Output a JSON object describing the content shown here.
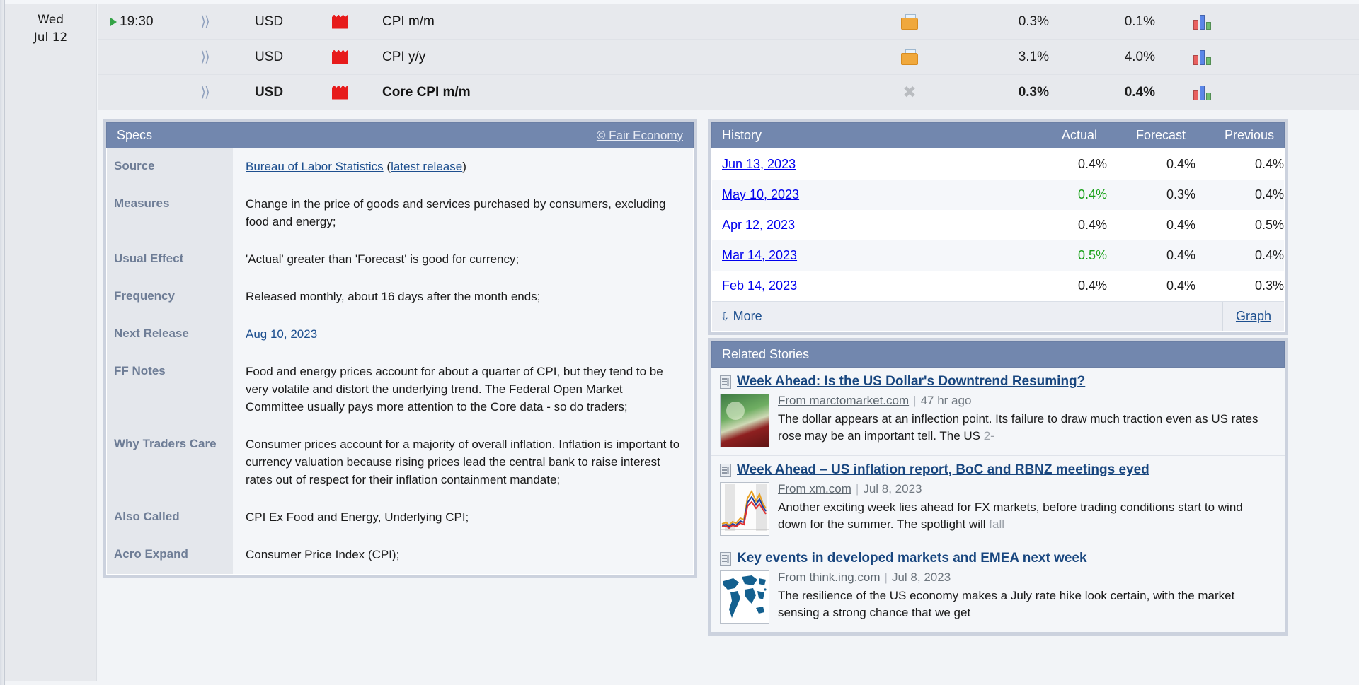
{
  "calendar": {
    "date": {
      "weekday": "Wed",
      "day": "Jul 12"
    },
    "rows": [
      {
        "time": "19:30",
        "has_play": true,
        "sound_icon": "sound-wave-icon",
        "currency": "USD",
        "impact_icon": "red-folder-flag-icon",
        "title": "CPI m/m",
        "detail_icon": "folder-document-icon",
        "actual": "0.3%",
        "forecast": "0.1%",
        "graph_icon": "bar-chart-icon",
        "bold": false
      },
      {
        "time": "",
        "has_play": false,
        "sound_icon": "sound-wave-icon",
        "currency": "USD",
        "impact_icon": "red-folder-flag-icon",
        "title": "CPI y/y",
        "detail_icon": "folder-document-icon",
        "actual": "3.1%",
        "forecast": "4.0%",
        "graph_icon": "bar-chart-icon",
        "bold": false
      },
      {
        "time": "",
        "has_play": false,
        "sound_icon": "sound-wave-icon",
        "currency": "USD",
        "impact_icon": "red-folder-flag-icon",
        "title": "Core CPI m/m",
        "detail_icon": "close-x-icon",
        "actual": "0.3%",
        "forecast": "0.4%",
        "graph_icon": "bar-chart-icon",
        "bold": true
      }
    ]
  },
  "specs": {
    "header_title": "Specs",
    "copyright_link": "© Fair Economy",
    "rows": [
      {
        "label": "Source",
        "value_prefix": "",
        "link1": "Bureau of Labor Statistics",
        "mid": " (",
        "link2": "latest release",
        "suffix": ")"
      },
      {
        "label": "Measures",
        "value": "Change in the price of goods and services purchased by consumers, excluding food and energy;"
      },
      {
        "label": "Usual Effect",
        "value": "'Actual' greater than 'Forecast' is good for currency;"
      },
      {
        "label": "Frequency",
        "value": "Released monthly, about 16 days after the month ends;"
      },
      {
        "label": "Next Release",
        "link1": "Aug 10, 2023"
      },
      {
        "label": "FF Notes",
        "value": "Food and energy prices account for about a quarter of CPI, but they tend to be very volatile and distort the underlying trend. The Federal Open Market Committee usually pays more attention to the Core data - so do traders;"
      },
      {
        "label": "Why Traders Care",
        "value": "Consumer prices account for a majority of overall inflation. Inflation is important to currency valuation because rising prices lead the central bank to raise interest rates out of respect for their inflation containment mandate;"
      },
      {
        "label": "Also Called",
        "value": "CPI Ex Food and Energy, Underlying CPI;"
      },
      {
        "label": "Acro Expand",
        "value": "Consumer Price Index (CPI);"
      }
    ]
  },
  "history": {
    "header_title": "History",
    "columns": [
      "Actual",
      "Forecast",
      "Previous"
    ],
    "rows": [
      {
        "date": "Jun 13, 2023",
        "actual": "0.4%",
        "actual_green": false,
        "forecast": "0.4%",
        "previous": "0.4%"
      },
      {
        "date": "May 10, 2023",
        "actual": "0.4%",
        "actual_green": true,
        "forecast": "0.3%",
        "previous": "0.4%"
      },
      {
        "date": "Apr 12, 2023",
        "actual": "0.4%",
        "actual_green": false,
        "forecast": "0.4%",
        "previous": "0.5%"
      },
      {
        "date": "Mar 14, 2023",
        "actual": "0.5%",
        "actual_green": true,
        "forecast": "0.4%",
        "previous": "0.4%"
      },
      {
        "date": "Feb 14, 2023",
        "actual": "0.4%",
        "actual_green": false,
        "forecast": "0.4%",
        "previous": "0.3%"
      }
    ],
    "more_label": "More",
    "more_icon": "download-arrow-icon",
    "graph_label": "Graph"
  },
  "related_stories": {
    "header_title": "Related Stories",
    "stories": [
      {
        "title": "Week Ahead: Is the US Dollar's Downtrend Resuming?",
        "source": "From marctomarket.com",
        "time": "47 hr ago",
        "description": "The dollar appears at an inflection point. Its failure to draw much traction even as US rates rose may be an important tell. The US ",
        "description_fade": "2-",
        "thumb": "money-photo-thumbnail"
      },
      {
        "title": "Week Ahead – US inflation report, BoC and RBNZ meetings eyed",
        "source": "From xm.com",
        "time": "Jul 8, 2023",
        "description": "Another exciting week lies ahead for FX markets, before trading conditions start to wind down for the summer. The spotlight will ",
        "description_fade": "fall",
        "thumb": "line-chart-thumbnail"
      },
      {
        "title": "Key events in developed markets and EMEA next week",
        "source": "From think.ing.com",
        "time": "Jul 8, 2023",
        "description": "The resilience of the US economy makes a July rate hike look certain, with the market sensing a strong chance that we get",
        "description_fade": "",
        "thumb": "world-map-thumbnail"
      }
    ]
  },
  "colors": {
    "panel_header": "#7287ae",
    "link": "#1d4f8f",
    "positive": "#1aa11a",
    "impact_high": "#e71b1b",
    "play": "#34a346"
  }
}
